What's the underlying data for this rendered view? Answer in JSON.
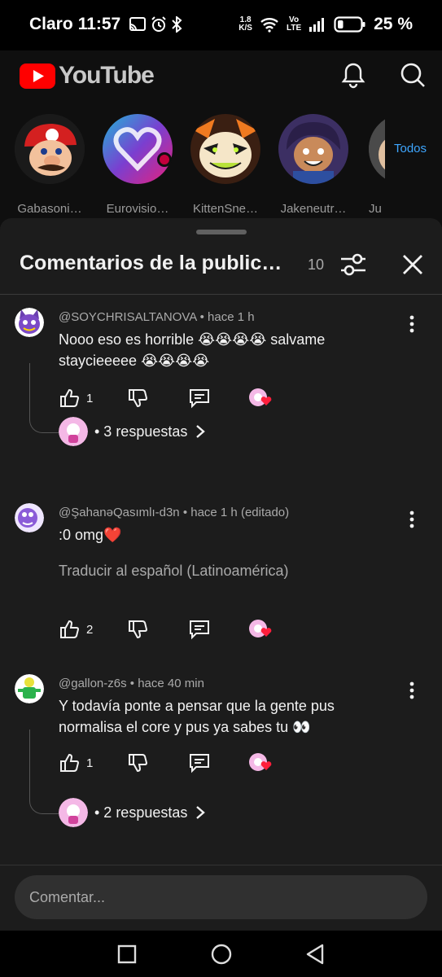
{
  "status_bar": {
    "carrier": "Claro",
    "time": "11:57",
    "speed_top": "1.8",
    "speed_bottom": "K/S",
    "volte_top": "Vo",
    "volte_bottom": "LTE",
    "battery": "25 %",
    "battery_level": 0.25
  },
  "header": {
    "app_name": "YouTube",
    "brand_color": "#ff0000"
  },
  "subscriptions": {
    "channels": [
      {
        "name": "Gabasoni…"
      },
      {
        "name": "Eurovisio…"
      },
      {
        "name": "KittenSne…"
      },
      {
        "name": "Jakeneutr…"
      },
      {
        "name": "Ju"
      }
    ],
    "all_label": "Todos"
  },
  "sheet": {
    "title": "Comentarios de la public…",
    "count": "10",
    "comments": [
      {
        "author": "@SOYCHRISALTANOVA",
        "time": "• hace 1 h",
        "text": "Nooo eso es horrible 😭😭😭😭 salvame staycieeeee 😭😭😭😭",
        "likes": "1",
        "replies": "• 3 respuestas"
      },
      {
        "author": "@ŞahanəQasımlı-d3n",
        "time": "• hace 1 h (editado)",
        "text": ":0 omg❤️",
        "translate": "Traducir al español (Latinoamérica)",
        "likes": "2"
      },
      {
        "author": "@gallon-z6s",
        "time": "• hace 40 min",
        "text": "Y todavía ponte a pensar que la gente pus normalisa el core y pus ya sabes tu 👀",
        "likes": "1",
        "replies": "• 2 respuestas"
      }
    ]
  },
  "composer": {
    "placeholder": "Comentar..."
  }
}
